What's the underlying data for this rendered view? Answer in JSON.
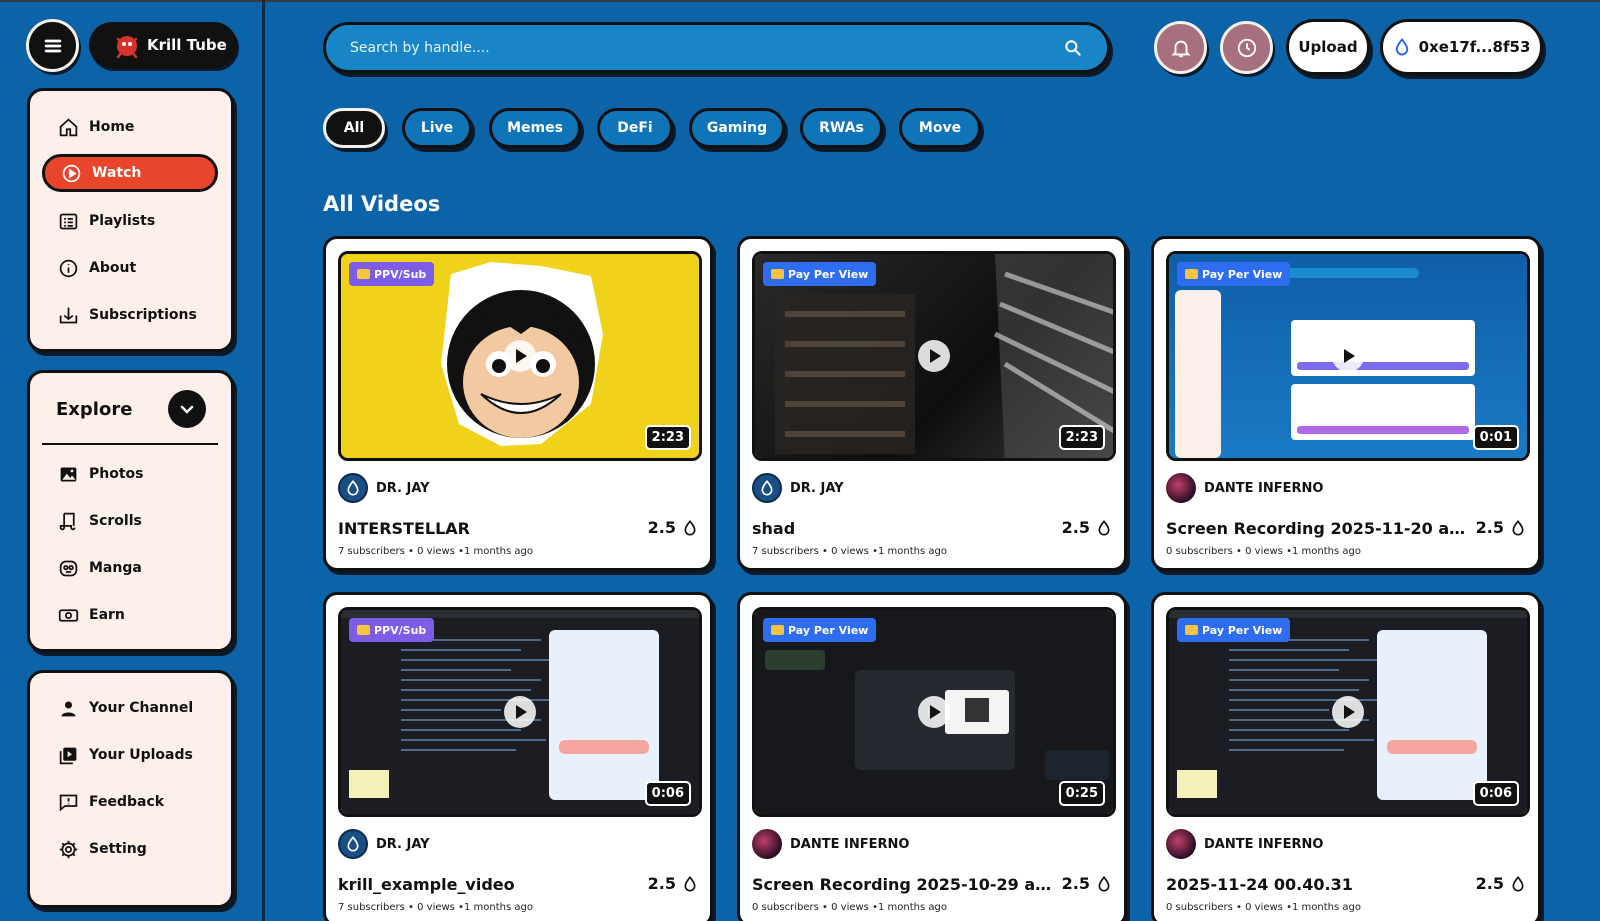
{
  "app": {
    "name": "Krill Tube"
  },
  "header": {
    "search_placeholder": "Search by handle....",
    "upload_label": "Upload",
    "wallet_label": "0xe17f...8f53"
  },
  "sidebar": {
    "main": [
      {
        "label": "Home",
        "icon": "home-icon"
      },
      {
        "label": "Watch",
        "icon": "play-circle-icon",
        "active": true
      },
      {
        "label": "Playlists",
        "icon": "playlist-icon"
      },
      {
        "label": "About",
        "icon": "info-icon"
      },
      {
        "label": "Subscriptions",
        "icon": "subscriptions-icon"
      }
    ],
    "explore": {
      "title": "Explore",
      "items": [
        {
          "label": "Photos",
          "icon": "image-icon"
        },
        {
          "label": "Scrolls",
          "icon": "scroll-icon"
        },
        {
          "label": "Manga",
          "icon": "manga-icon"
        },
        {
          "label": "Earn",
          "icon": "money-icon"
        }
      ]
    },
    "account": [
      {
        "label": "Your Channel",
        "icon": "user-icon"
      },
      {
        "label": "Your Uploads",
        "icon": "uploads-icon"
      },
      {
        "label": "Feedback",
        "icon": "feedback-icon"
      },
      {
        "label": "Setting",
        "icon": "gear-icon"
      }
    ]
  },
  "filters": [
    "All",
    "Live",
    "Memes",
    "DeFi",
    "Gaming",
    "RWAs",
    "Move"
  ],
  "section_title": "All Videos",
  "videos": [
    {
      "badge": "PPV/Sub",
      "duration": "2:23",
      "creator": "DR. JAY",
      "title": "INTERSTELLAR",
      "price": "2.5",
      "meta": "7 subscribers • 0 views •1 months ago"
    },
    {
      "badge": "Pay Per View",
      "duration": "2:23",
      "creator": "DR. JAY",
      "title": "shad",
      "price": "2.5",
      "meta": "7 subscribers • 0 views •1 months ago"
    },
    {
      "badge": "Pay Per View",
      "duration": "0:01",
      "creator": "DANTE INFERNO",
      "title": "Screen Recording 2025-11-20 at...",
      "price": "2.5",
      "meta": "0 subscribers • 0 views •1 months ago"
    },
    {
      "badge": "PPV/Sub",
      "duration": "0:06",
      "creator": "DR. JAY",
      "title": "krill_example_video",
      "price": "2.5",
      "meta": "7 subscribers • 0 views •1 months ago"
    },
    {
      "badge": "Pay Per View",
      "duration": "0:25",
      "creator": "DANTE INFERNO",
      "title": "Screen Recording 2025-10-29 at...",
      "price": "2.5",
      "meta": "0 subscribers • 0 views •1 months ago"
    },
    {
      "badge": "Pay Per View",
      "duration": "0:06",
      "creator": "DANTE INFERNO",
      "title": "2025-11-24 00.40.31",
      "price": "2.5",
      "meta": "0 subscribers • 0 views •1 months ago"
    }
  ],
  "colors": {
    "background": "#0c63a8",
    "accent_active": "#e8452c",
    "card": "#fdf0ea",
    "badge_ppv": "#2f6df0",
    "badge_sub": "#7d5ce6"
  }
}
